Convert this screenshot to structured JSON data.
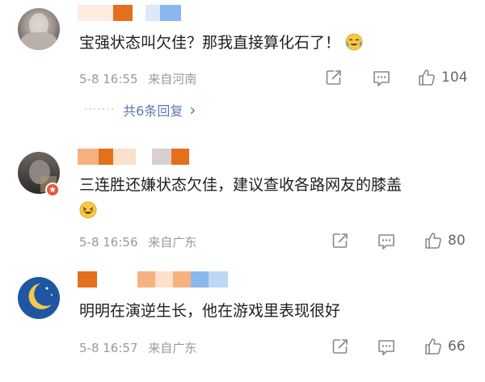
{
  "comments": [
    {
      "text": "宝强状态叫欠佳？那我直接算化石了！",
      "emoji": "crying-laughing-emoji",
      "date": "5-8 16:55",
      "location": "来自河南",
      "likes": "104"
    },
    {
      "text_line1": "三连胜还嫌状态欠佳，建议查收各路网友的膝盖",
      "emoji": "laughing-emoji",
      "date": "5-8 16:56",
      "location": "来自广东",
      "likes": "80"
    },
    {
      "text": "明明在演逆生长，他在游戏里表现很好",
      "date": "5-8 16:57",
      "location": "来自广东",
      "likes": "66"
    }
  ],
  "replies": {
    "dots": "·······",
    "label": "共6条回复",
    "chevron": "›"
  },
  "colors": {
    "meta": "#999999",
    "link": "#5b77b1",
    "icon": "#888888",
    "username_blocks": [
      "#f6b27e",
      "#e46f1c",
      "#fbe0cb",
      "#8ab8ee",
      "#bdd8f5"
    ]
  }
}
